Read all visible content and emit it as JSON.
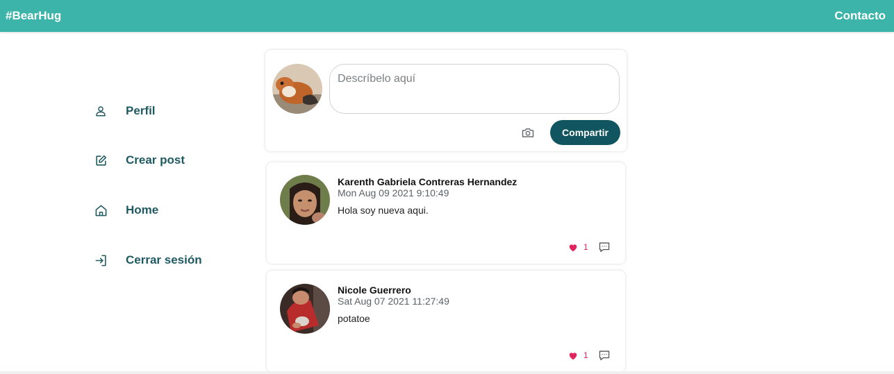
{
  "header": {
    "brand": "#BearHug",
    "contact": "Contacto"
  },
  "sidebar": {
    "items": [
      {
        "label": "Perfil",
        "icon": "user-icon"
      },
      {
        "label": "Crear post",
        "icon": "edit-icon"
      },
      {
        "label": "Home",
        "icon": "home-icon"
      },
      {
        "label": "Cerrar sesión",
        "icon": "logout-icon"
      }
    ]
  },
  "composer": {
    "placeholder": "Descríbelo aquí",
    "value": "",
    "share_label": "Compartir",
    "camera_icon": "camera-icon"
  },
  "posts": [
    {
      "author": "Karenth Gabriela Contreras Hernandez",
      "date": "Mon Aug 09 2021 9:10:49",
      "text": "Hola soy nueva aqui.",
      "likes": "1"
    },
    {
      "author": "Nicole Guerrero",
      "date": "Sat Aug 07 2021 11:27:49",
      "text": "potatoe",
      "likes": "1"
    }
  ],
  "colors": {
    "header_bg": "#3cb4aa",
    "accent_dark": "#105560",
    "sidebar_text": "#1f5a62",
    "like": "#e0245e"
  }
}
